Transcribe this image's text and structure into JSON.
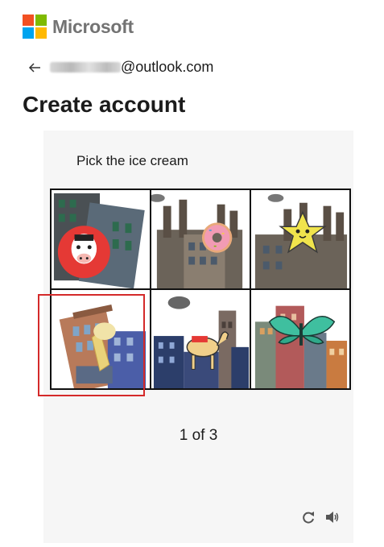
{
  "brand": {
    "name": "Microsoft",
    "colors": [
      "#f25022",
      "#7fba00",
      "#00a4ef",
      "#ffb900"
    ]
  },
  "identity": {
    "back_icon": "arrow-left-icon",
    "email_suffix": "@outlook.com"
  },
  "page": {
    "title": "Create account"
  },
  "challenge": {
    "prompt": "Pick the ice cream",
    "tiles": [
      {
        "icon": "cow-icon"
      },
      {
        "icon": "donut-icon"
      },
      {
        "icon": "star-icon"
      },
      {
        "icon": "ice-cream-icon"
      },
      {
        "icon": "camel-icon"
      },
      {
        "icon": "butterfly-icon"
      }
    ],
    "highlight_color": "#d42a2a",
    "counter": "1 of 3",
    "controls": {
      "refresh_icon": "refresh-icon",
      "audio_icon": "speaker-icon"
    }
  }
}
